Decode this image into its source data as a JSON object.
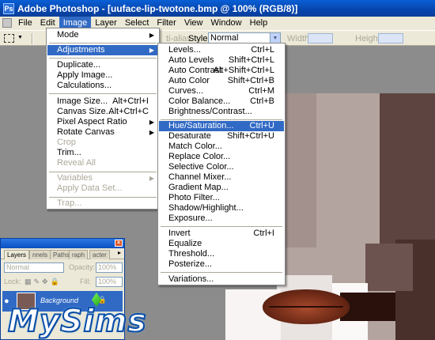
{
  "window": {
    "title": "Adobe Photoshop - [uuface-lip-twotone.bmp @ 100% (RGB/8)]"
  },
  "menubar": {
    "items": [
      "File",
      "Edit",
      "Image",
      "Layer",
      "Select",
      "Filter",
      "View",
      "Window",
      "Help"
    ],
    "active": "Image"
  },
  "options": {
    "anti_alias": "ti-alias",
    "style_label": "Style:",
    "style_value": "Normal",
    "width_label": "Width:",
    "height_label": "Height:"
  },
  "image_menu": {
    "mode": "Mode",
    "adjustments": "Adjustments",
    "duplicate": "Duplicate...",
    "apply_image": "Apply Image...",
    "calculations": "Calculations...",
    "image_size": "Image Size...",
    "image_size_sc": "Alt+Ctrl+I",
    "canvas_size": "Canvas Size...",
    "canvas_size_sc": "Alt+Ctrl+C",
    "pixel_aspect": "Pixel Aspect Ratio",
    "rotate_canvas": "Rotate Canvas",
    "crop": "Crop",
    "trim": "Trim...",
    "reveal_all": "Reveal All",
    "variables": "Variables",
    "apply_data_set": "Apply Data Set...",
    "trap": "Trap..."
  },
  "adjustments_menu": {
    "levels": "Levels...",
    "levels_sc": "Ctrl+L",
    "auto_levels": "Auto Levels",
    "auto_levels_sc": "Shift+Ctrl+L",
    "auto_contrast": "Auto Contrast",
    "auto_contrast_sc": "Alt+Shift+Ctrl+L",
    "auto_color": "Auto Color",
    "auto_color_sc": "Shift+Ctrl+B",
    "curves": "Curves...",
    "curves_sc": "Ctrl+M",
    "color_balance": "Color Balance...",
    "color_balance_sc": "Ctrl+B",
    "brightness_contrast": "Brightness/Contrast...",
    "hue_saturation": "Hue/Saturation...",
    "hue_saturation_sc": "Ctrl+U",
    "desaturate": "Desaturate",
    "desaturate_sc": "Shift+Ctrl+U",
    "match_color": "Match Color...",
    "replace_color": "Replace Color...",
    "selective_color": "Selective Color...",
    "channel_mixer": "Channel Mixer...",
    "gradient_map": "Gradient Map...",
    "photo_filter": "Photo Filter...",
    "shadow_highlight": "Shadow/Highlight...",
    "exposure": "Exposure...",
    "invert": "Invert",
    "invert_sc": "Ctrl+I",
    "equalize": "Equalize",
    "threshold": "Threshold...",
    "posterize": "Posterize...",
    "variations": "Variations..."
  },
  "layers_panel": {
    "tabs": [
      "Layers",
      "nnels",
      "Paths",
      "raph",
      "acter"
    ],
    "blend_mode": "Normal",
    "opacity_label": "Opacity:",
    "opacity_value": "100%",
    "lock_label": "Lock:",
    "fill_label": "Fill:",
    "fill_value": "100%",
    "layer_name": "Background"
  },
  "logo_text": "MySims"
}
